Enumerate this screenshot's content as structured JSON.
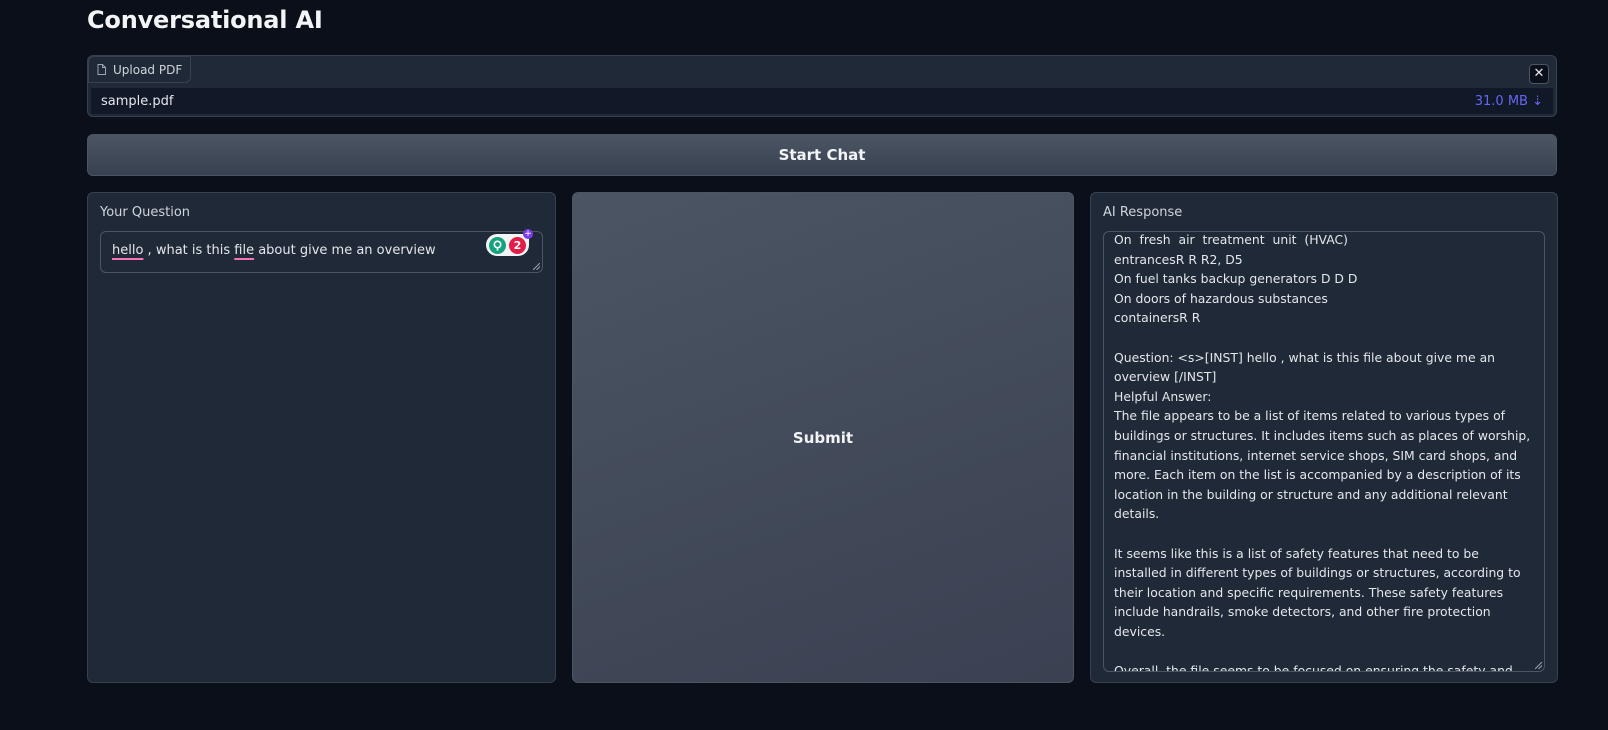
{
  "page": {
    "title": "Conversational AI"
  },
  "upload": {
    "label": "Upload PDF",
    "file_name": "sample.pdf",
    "file_size": "31.0 MB ⇣",
    "clear_icon": "close-icon",
    "label_icon": "file-icon"
  },
  "actions": {
    "start_label": "Start Chat",
    "submit_label": "Submit"
  },
  "question": {
    "label": "Your Question",
    "words": [
      "hello",
      " , what is this ",
      "file",
      " about give me an overview"
    ],
    "grammar_count": "2"
  },
  "response": {
    "label": "AI Response",
    "text": "On  fresh  air  treatment  unit  (HVAC)\nentrancesR R R2, D5\nOn fuel tanks backup generators D D D\nOn doors of hazardous substances\ncontainersR R\n\nQuestion: <s>[INST] hello , what is this file about give me an overview [/INST]\nHelpful Answer:\nThe file appears to be a list of items related to various types of buildings or structures. It includes items such as places of worship, financial institutions, internet service shops, SIM card shops, and more. Each item on the list is accompanied by a description of its location in the building or structure and any additional relevant details.\n\nIt seems like this is a list of safety features that need to be installed in different types of buildings or structures, according to their location and specific requirements. These safety features include handrails, smoke detectors, and other fire protection devices.\n\nOverall, the file seems to be focused on ensuring the safety and well-being of individuals in various types of buildings and structures."
  },
  "colors": {
    "background": "#0b0f19",
    "panel": "#1f2937",
    "accent": "#6366f1",
    "button": "#4b5563"
  }
}
